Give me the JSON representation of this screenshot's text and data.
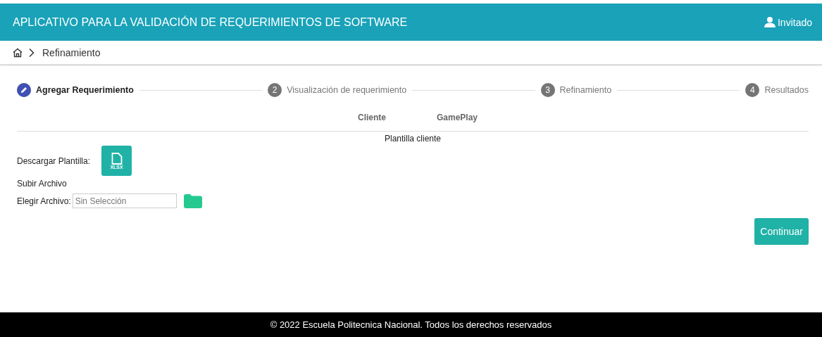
{
  "header": {
    "title": "APLICATIVO PARA LA VALIDACIÓN DE REQUERIMIENTOS DE SOFTWARE",
    "user": "Invitado"
  },
  "breadcrumb": {
    "current": "Refinamiento"
  },
  "steps": [
    {
      "label": "Agregar Requerimiento",
      "selected": true
    },
    {
      "number": "2",
      "label": "Visualización de requerimiento",
      "selected": false
    },
    {
      "number": "3",
      "label": "Refinamiento",
      "selected": false
    },
    {
      "number": "4",
      "label": "Resultados",
      "selected": false
    }
  ],
  "tabs": [
    {
      "label": "Cliente"
    },
    {
      "label": "GamePlay"
    }
  ],
  "panel_title": "Plantilla cliente",
  "download": {
    "label": "Descargar Plantilla:",
    "button": "XLSX"
  },
  "upload": {
    "title": "Subir Archivo",
    "label": "Elegir Archivo:",
    "placeholder": "Sin Selección"
  },
  "continue_button": "Continuar",
  "footer": "© 2022 Escuela Politecnica Nacional. Todos los derechos reservados"
}
